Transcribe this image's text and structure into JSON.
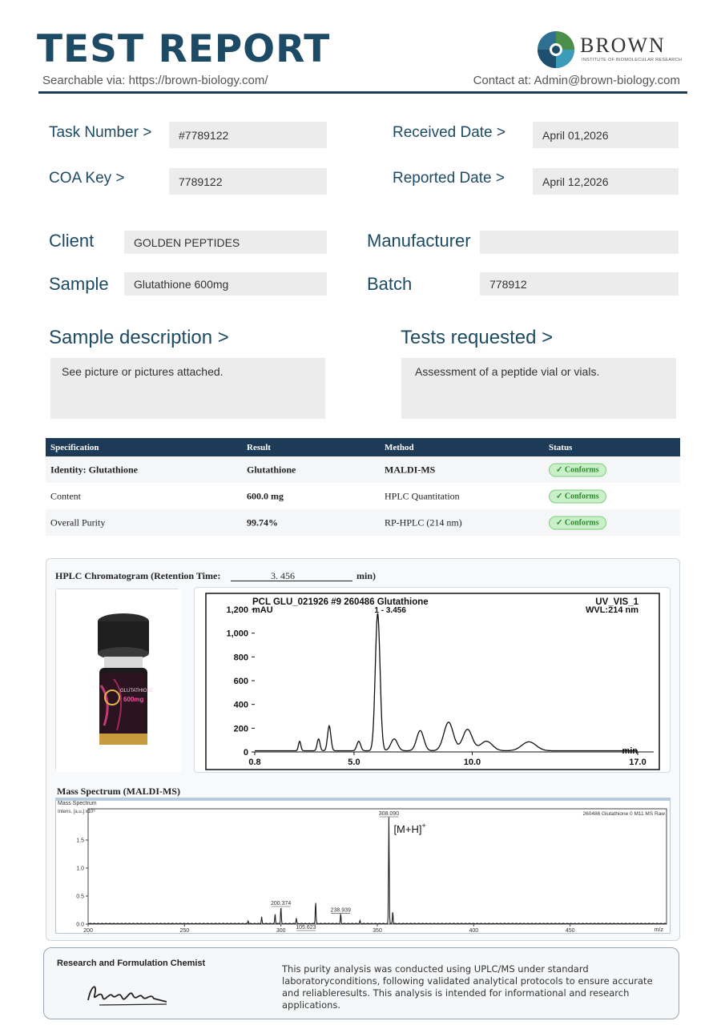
{
  "header": {
    "title": "TEST REPORT",
    "searchable": "Searchable via: https://brown-biology.com/",
    "contact": "Contact at: Admin@brown-biology.com",
    "brand_name": "BROWN",
    "brand_subtitle": "INSTITUTE OF BIOMOLECULAR RESEARCH",
    "brand_color": "#1d4a64"
  },
  "fields": {
    "task_number_label": "Task Number  >",
    "task_number": "#7789122",
    "received_date_label": "Received Date  >",
    "received_date": "April 01,2026",
    "coa_key_label": "COA  Key >",
    "coa_key": "7789122",
    "reported_date_label": "Reported Date >",
    "reported_date": "April 12,2026",
    "client_label": "Client",
    "client": "GOLDEN PEPTIDES",
    "manufacturer_label": "Manufacturer",
    "manufacturer": "",
    "sample_label": "Sample",
    "sample": "Glutathione 600mg",
    "batch_label": "Batch",
    "batch": "778912"
  },
  "sample_description": {
    "heading": "Sample description   >",
    "text": "See picture or pictures attached."
  },
  "tests_requested": {
    "heading": "Tests requested   >",
    "text": "Assessment of a peptide vial or vials."
  },
  "results_table": {
    "headers": [
      "Specification",
      "Result",
      "Method",
      "Status"
    ],
    "rows": [
      {
        "spec": "Identity:  Glutathione",
        "result": "Glutathione",
        "method": "MALDI-MS",
        "status": "✓ Conforms"
      },
      {
        "spec": "Content",
        "result": "600.0 mg",
        "method": "HPLC Quantitation",
        "status": "✓ Conforms"
      },
      {
        "spec": "Overall Purity",
        "result": "99.74%",
        "method": "RP-HPLC (214 nm)",
        "status": "✓ Conforms"
      }
    ],
    "header_color": "#1d3b56",
    "status_color": "#2b8a2b"
  },
  "hplc": {
    "heading": "HPLC Chromatogram (Retention Time:",
    "retention_time": "3. 456",
    "unit_close": "min)"
  },
  "vial_label": {
    "product": "GLUTATHIONE",
    "dose": "600mg"
  },
  "chart_data": [
    {
      "type": "line",
      "title": "PCL GLU_021926 #9    260486 Glutathione",
      "top_right": "UV_VIS_1",
      "wavelength": "WVL:214 nm",
      "ylabel": "mAU",
      "xlabel": "min",
      "xlim": [
        0.8,
        17.0
      ],
      "ylim": [
        0,
        1200
      ],
      "x_ticks": [
        "0.8",
        "5.0",
        "10.0",
        "17.0"
      ],
      "y_ticks": [
        "0",
        "200",
        "400",
        "600",
        "800",
        "1,000",
        "1,200"
      ],
      "peak_label": "1 - 3.456",
      "baseline": 10,
      "peaks": [
        {
          "x": 2.7,
          "height": 80,
          "width": 0.05
        },
        {
          "x": 3.5,
          "height": 100,
          "width": 0.06
        },
        {
          "x": 3.95,
          "height": 210,
          "width": 0.07
        },
        {
          "x": 5.2,
          "height": 80,
          "width": 0.08
        },
        {
          "x": 6.0,
          "height": 1160,
          "width": 0.1
        },
        {
          "x": 6.7,
          "height": 100,
          "width": 0.14
        },
        {
          "x": 7.8,
          "height": 170,
          "width": 0.15
        },
        {
          "x": 9.0,
          "height": 240,
          "width": 0.2
        },
        {
          "x": 9.8,
          "height": 180,
          "width": 0.2
        },
        {
          "x": 10.6,
          "height": 80,
          "width": 0.25
        },
        {
          "x": 12.4,
          "height": 75,
          "width": 0.3
        }
      ]
    },
    {
      "type": "line",
      "title": "Mass Spectrum (MALDI-MS)",
      "panel_label": "Mass Spectrum",
      "sample_tag": "260486 Glutathione 0 M11 MS Raw",
      "ylabel": "Intens. [a.u.] x10⁶",
      "xlabel": "m/z",
      "xlim": [
        200,
        500
      ],
      "ylim": [
        0,
        2.0
      ],
      "x_ticks": [
        "200",
        "250",
        "300",
        "350",
        "400",
        "450"
      ],
      "y_ticks": [
        "0.0",
        "0.5",
        "1.0",
        "1.5"
      ],
      "peak_annotation": "[M+H]",
      "peak_annotation_sup": "+",
      "peaks": [
        {
          "x": 283,
          "height": 0.05,
          "label": ""
        },
        {
          "x": 290,
          "height": 0.12,
          "label": ""
        },
        {
          "x": 297,
          "height": 0.18,
          "label": ""
        },
        {
          "x": 300,
          "height": 0.3,
          "label": "200.374"
        },
        {
          "x": 308,
          "height": 0.1,
          "label": "105.623"
        },
        {
          "x": 318,
          "height": 0.4,
          "label": ""
        },
        {
          "x": 331,
          "height": 0.18,
          "label": "238.939"
        },
        {
          "x": 341,
          "height": 0.05,
          "label": ""
        },
        {
          "x": 356,
          "height": 1.9,
          "label": "308.090"
        },
        {
          "x": 358,
          "height": 0.22,
          "label": ""
        }
      ]
    }
  ],
  "footer": {
    "chemist_title": "Research and Formulation Chemist",
    "signature": "Bisbang",
    "disclaimer": "This purity analysis was conducted using UPLC/MS under standard laboratoryconditions, following validated analytical protocols to ensure accurate and reliableresults. This analysis is intended for informational and research applications."
  }
}
